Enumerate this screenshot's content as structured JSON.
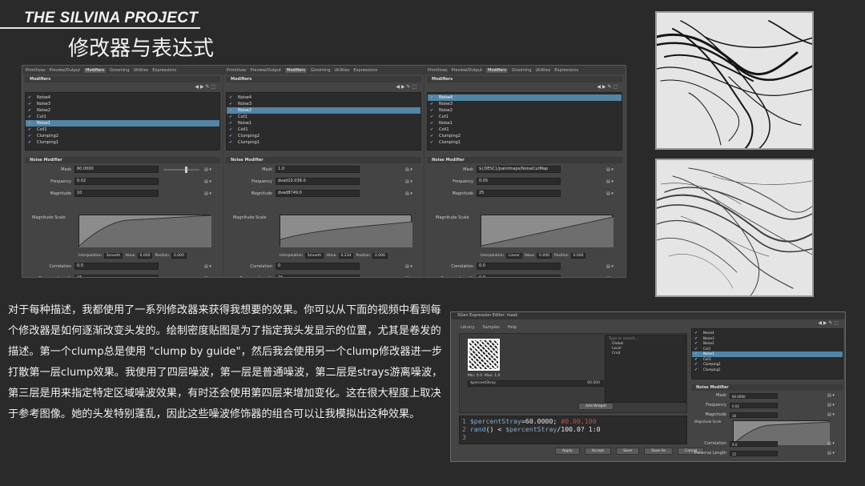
{
  "header": {
    "brand": "THE SILVINA PROJECT",
    "subtitle": "修改器与表达式"
  },
  "maya": {
    "tabs": [
      "Primitives",
      "Preview/Output",
      "Modifiers",
      "Grooming",
      "Utilities",
      "Expressions"
    ],
    "active_tab": "Modifiers",
    "section_modifiers": "Modifiers",
    "section_noise": "Noise Modifier",
    "columns": [
      {
        "list": [
          "Noise4",
          "Noise3",
          "Noise2",
          "Cut1",
          "Noise1",
          "Coil1",
          "Clumping2",
          "Clumping1"
        ],
        "selected": 4,
        "mask": "60.0000",
        "frequency": "0.02",
        "magnitude": "10",
        "correlation": "0.0",
        "preserve_length": "15",
        "interp": "Smooth",
        "value": "0.000",
        "position": "0.000"
      },
      {
        "list": [
          "Noise4",
          "Noise3",
          "Noise2",
          "Cut1",
          "Noise1",
          "Coil1",
          "Clumping2",
          "Clumping1"
        ],
        "selected": 2,
        "mask": "1.0",
        "frequency": "dvad10.038.0",
        "magnitude": "dvad8749.0",
        "correlation": "0",
        "preserve_length": "15",
        "interp": "Smooth",
        "value": "0.234",
        "position": "0.000"
      },
      {
        "list": [
          "Noise4",
          "Noise3",
          "Noise2",
          "Cut1",
          "Noise1",
          "Coil1",
          "Clumping2",
          "Clumping1"
        ],
        "selected": 0,
        "mask": "${DESC}/paintmaps/NoiseCutMap",
        "frequency": "0.05",
        "magnitude": "25",
        "correlation": "0.0",
        "preserve_length": "0.0",
        "interp": "Linear",
        "value": "0.000",
        "position": "0.000"
      }
    ],
    "labels": {
      "mask": "Mask",
      "frequency": "Frequency",
      "magnitude": "Magnitude",
      "magnitude_scale": "Magnitude Scale",
      "correlation": "Correlation",
      "preserve_length": "Preserve Length",
      "interpolation": "Interpolation",
      "value": "Value",
      "position": "Position"
    }
  },
  "description": "对于每种描述，我都使用了一系列修改器来获得我想要的效果。你可以从下面的视频中看到每个修改器是如何逐渐改变头发的。绘制密度贴图是为了指定我头发显示的位置，尤其是卷发的描述。第一个clump总是使用 \"clump by guide\"，然后我会使用另一个clump修改器进一步打散第一层clump效果。我使用了四层噪波，第一层是普通噪波，第二层是strays游离噪波，第三层是用来指定特定区域噪波效果，有时还会使用第四层来增加变化。这在很大程度上取决于参考图像。她的头发特别蓬乱，因此这些噪波修饰器的组合可以让我模拟出这种效果。",
  "editor": {
    "title": "XGen Expression Editor: mask",
    "tabs": [
      "Library",
      "Samples",
      "Help"
    ],
    "search_placeholder": "Type to search...",
    "vars": [
      "Global",
      "Local",
      "Cmd"
    ],
    "var_row": "$percentStray",
    "var_value": "60.000",
    "min_label": "Min: 0.0",
    "max_label": "Max: 1.0",
    "add_widget": "Add Widget",
    "code_lines": [
      {
        "n": "1",
        "parts": [
          [
            "v",
            "$percentStray"
          ],
          [
            "num",
            "=60.0000; "
          ],
          [
            "com",
            "#0.00,100"
          ]
        ]
      },
      {
        "n": "2",
        "parts": [
          [
            "fn",
            "rand"
          ],
          [
            "num",
            "() < "
          ],
          [
            "v",
            "$percentStray"
          ],
          [
            "num",
            "/100.0? 1:0"
          ]
        ]
      },
      {
        "n": "3",
        "parts": []
      }
    ],
    "buttons": [
      "Apply",
      "Accept",
      "Save",
      "Save As",
      "Cancel"
    ],
    "right_list": [
      "Noise4",
      "Noise3",
      "Noise2",
      "Cut1",
      "Noise1",
      "Coil1",
      "Clumping2",
      "Clumping1"
    ],
    "right_selected": 4,
    "right_section": "Noise Modifier",
    "right_mask": "60.0000",
    "right_frequency": "0.02",
    "right_magnitude": "10",
    "right_correlation": "0.0",
    "right_preserve": "15"
  }
}
